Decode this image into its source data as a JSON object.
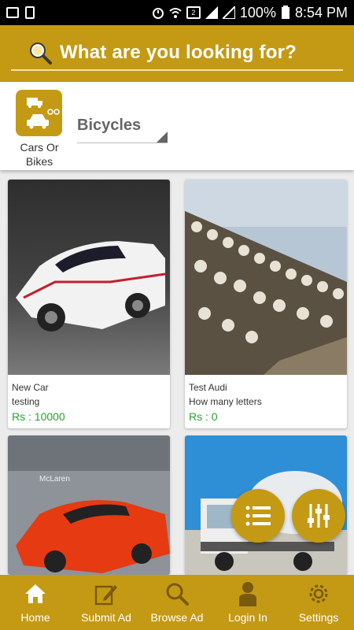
{
  "status_bar": {
    "battery": "100%",
    "time": "8:54 PM",
    "icons": [
      "photo-icon",
      "sd-icon",
      "alarm-icon",
      "wifi-icon",
      "sim2-icon",
      "signal-icon",
      "signal2-icon"
    ]
  },
  "search": {
    "placeholder": "What are you looking for?"
  },
  "category": {
    "label": "Cars Or Bikes",
    "selected": "Bicycles"
  },
  "listings": [
    {
      "title": "New Car",
      "description": "testing",
      "price": "Rs : 10000"
    },
    {
      "title": "Test Audi",
      "description": "How many letters",
      "price": "Rs : 0"
    },
    {
      "title": "",
      "description": "",
      "price": ""
    },
    {
      "title": "",
      "description": "",
      "price": ""
    }
  ],
  "image_text": {
    "mclaren_sign": "McLaren"
  },
  "nav": [
    {
      "label": "Home",
      "icon": "home-icon"
    },
    {
      "label": "Submit Ad",
      "icon": "edit-icon"
    },
    {
      "label": "Browse Ad",
      "icon": "search-icon"
    },
    {
      "label": "Login In",
      "icon": "user-icon"
    },
    {
      "label": "Settings",
      "icon": "gear-icon"
    }
  ],
  "colors": {
    "accent": "#c49a14",
    "price": "#27a32d"
  }
}
